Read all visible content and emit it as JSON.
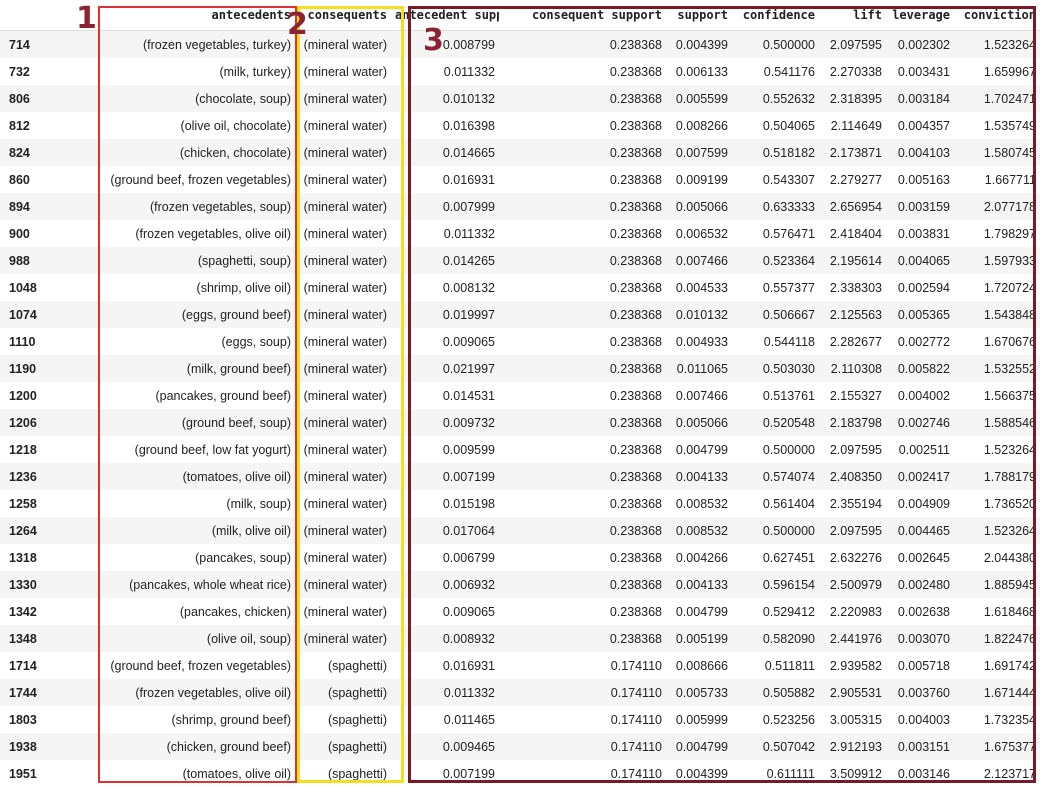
{
  "table": {
    "columns": [
      "",
      "antecedents",
      "consequents",
      "antecedent support",
      "consequent support",
      "support",
      "confidence",
      "lift",
      "leverage",
      "conviction"
    ],
    "rows": [
      [
        "714",
        "(frozen vegetables, turkey)",
        "(mineral water)",
        "0.008799",
        "0.238368",
        "0.004399",
        "0.500000",
        "2.097595",
        "0.002302",
        "1.523264"
      ],
      [
        "732",
        "(milk, turkey)",
        "(mineral water)",
        "0.011332",
        "0.238368",
        "0.006133",
        "0.541176",
        "2.270338",
        "0.003431",
        "1.659967"
      ],
      [
        "806",
        "(chocolate, soup)",
        "(mineral water)",
        "0.010132",
        "0.238368",
        "0.005599",
        "0.552632",
        "2.318395",
        "0.003184",
        "1.702471"
      ],
      [
        "812",
        "(olive oil, chocolate)",
        "(mineral water)",
        "0.016398",
        "0.238368",
        "0.008266",
        "0.504065",
        "2.114649",
        "0.004357",
        "1.535749"
      ],
      [
        "824",
        "(chicken, chocolate)",
        "(mineral water)",
        "0.014665",
        "0.238368",
        "0.007599",
        "0.518182",
        "2.173871",
        "0.004103",
        "1.580745"
      ],
      [
        "860",
        "(ground beef, frozen vegetables)",
        "(mineral water)",
        "0.016931",
        "0.238368",
        "0.009199",
        "0.543307",
        "2.279277",
        "0.005163",
        "1.667711"
      ],
      [
        "894",
        "(frozen vegetables, soup)",
        "(mineral water)",
        "0.007999",
        "0.238368",
        "0.005066",
        "0.633333",
        "2.656954",
        "0.003159",
        "2.077178"
      ],
      [
        "900",
        "(frozen vegetables, olive oil)",
        "(mineral water)",
        "0.011332",
        "0.238368",
        "0.006532",
        "0.576471",
        "2.418404",
        "0.003831",
        "1.798297"
      ],
      [
        "988",
        "(spaghetti, soup)",
        "(mineral water)",
        "0.014265",
        "0.238368",
        "0.007466",
        "0.523364",
        "2.195614",
        "0.004065",
        "1.597933"
      ],
      [
        "1048",
        "(shrimp, olive oil)",
        "(mineral water)",
        "0.008132",
        "0.238368",
        "0.004533",
        "0.557377",
        "2.338303",
        "0.002594",
        "1.720724"
      ],
      [
        "1074",
        "(eggs, ground beef)",
        "(mineral water)",
        "0.019997",
        "0.238368",
        "0.010132",
        "0.506667",
        "2.125563",
        "0.005365",
        "1.543848"
      ],
      [
        "1110",
        "(eggs, soup)",
        "(mineral water)",
        "0.009065",
        "0.238368",
        "0.004933",
        "0.544118",
        "2.282677",
        "0.002772",
        "1.670676"
      ],
      [
        "1190",
        "(milk, ground beef)",
        "(mineral water)",
        "0.021997",
        "0.238368",
        "0.011065",
        "0.503030",
        "2.110308",
        "0.005822",
        "1.532552"
      ],
      [
        "1200",
        "(pancakes, ground beef)",
        "(mineral water)",
        "0.014531",
        "0.238368",
        "0.007466",
        "0.513761",
        "2.155327",
        "0.004002",
        "1.566375"
      ],
      [
        "1206",
        "(ground beef, soup)",
        "(mineral water)",
        "0.009732",
        "0.238368",
        "0.005066",
        "0.520548",
        "2.183798",
        "0.002746",
        "1.588546"
      ],
      [
        "1218",
        "(ground beef, low fat yogurt)",
        "(mineral water)",
        "0.009599",
        "0.238368",
        "0.004799",
        "0.500000",
        "2.097595",
        "0.002511",
        "1.523264"
      ],
      [
        "1236",
        "(tomatoes, olive oil)",
        "(mineral water)",
        "0.007199",
        "0.238368",
        "0.004133",
        "0.574074",
        "2.408350",
        "0.002417",
        "1.788179"
      ],
      [
        "1258",
        "(milk, soup)",
        "(mineral water)",
        "0.015198",
        "0.238368",
        "0.008532",
        "0.561404",
        "2.355194",
        "0.004909",
        "1.736520"
      ],
      [
        "1264",
        "(milk, olive oil)",
        "(mineral water)",
        "0.017064",
        "0.238368",
        "0.008532",
        "0.500000",
        "2.097595",
        "0.004465",
        "1.523264"
      ],
      [
        "1318",
        "(pancakes, soup)",
        "(mineral water)",
        "0.006799",
        "0.238368",
        "0.004266",
        "0.627451",
        "2.632276",
        "0.002645",
        "2.044380"
      ],
      [
        "1330",
        "(pancakes, whole wheat rice)",
        "(mineral water)",
        "0.006932",
        "0.238368",
        "0.004133",
        "0.596154",
        "2.500979",
        "0.002480",
        "1.885945"
      ],
      [
        "1342",
        "(pancakes, chicken)",
        "(mineral water)",
        "0.009065",
        "0.238368",
        "0.004799",
        "0.529412",
        "2.220983",
        "0.002638",
        "1.618468"
      ],
      [
        "1348",
        "(olive oil, soup)",
        "(mineral water)",
        "0.008932",
        "0.238368",
        "0.005199",
        "0.582090",
        "2.441976",
        "0.003070",
        "1.822476"
      ],
      [
        "1714",
        "(ground beef, frozen vegetables)",
        "(spaghetti)",
        "0.016931",
        "0.174110",
        "0.008666",
        "0.511811",
        "2.939582",
        "0.005718",
        "1.691742"
      ],
      [
        "1744",
        "(frozen vegetables, olive oil)",
        "(spaghetti)",
        "0.011332",
        "0.174110",
        "0.005733",
        "0.505882",
        "2.905531",
        "0.003760",
        "1.671444"
      ],
      [
        "1803",
        "(shrimp, ground beef)",
        "(spaghetti)",
        "0.011465",
        "0.174110",
        "0.005999",
        "0.523256",
        "3.005315",
        "0.004003",
        "1.732354"
      ],
      [
        "1938",
        "(chicken, ground beef)",
        "(spaghetti)",
        "0.009465",
        "0.174110",
        "0.004799",
        "0.507042",
        "2.912193",
        "0.003151",
        "1.675377"
      ],
      [
        "1951",
        "(tomatoes, olive oil)",
        "(spaghetti)",
        "0.007199",
        "0.174110",
        "0.004399",
        "0.611111",
        "3.509912",
        "0.003146",
        "2.123717"
      ]
    ]
  },
  "annotations": {
    "label_1": "1",
    "label_2": "2",
    "label_3": "3",
    "colors": {
      "box_1": "#e03030",
      "box_2": "#f0e020",
      "box_3": "#7a1a28",
      "label": "#8b2332"
    }
  }
}
